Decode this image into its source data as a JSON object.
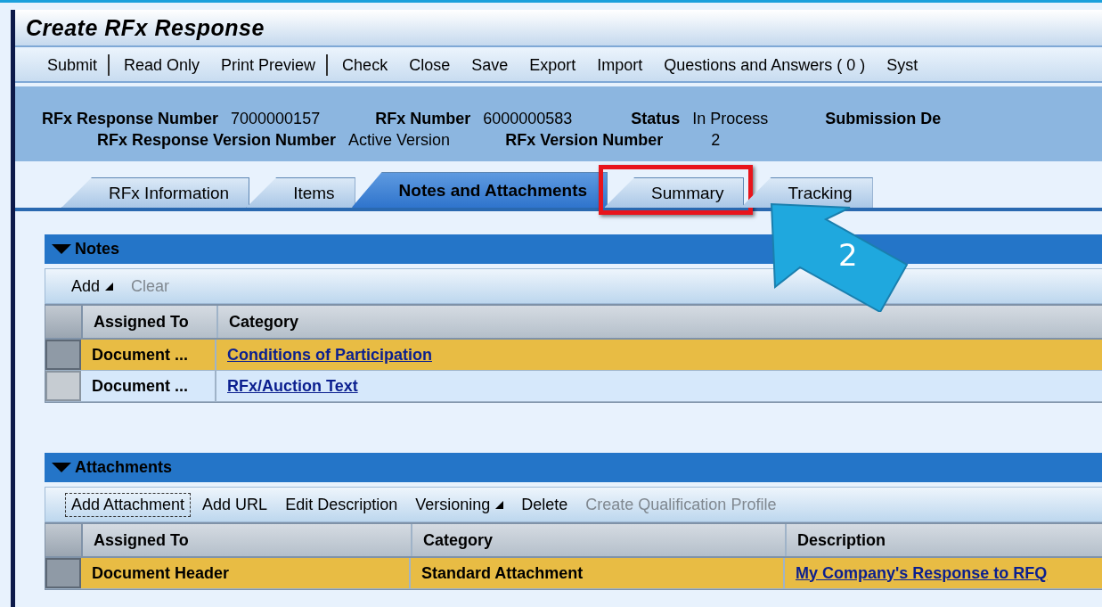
{
  "window": {
    "title": "Create RFx Response"
  },
  "toolbar": [
    {
      "label": "Submit",
      "separator_after": true
    },
    {
      "label": "Read Only",
      "separator_after": false
    },
    {
      "label": "Print Preview",
      "separator_after": true
    },
    {
      "label": "Check",
      "separator_after": false
    },
    {
      "label": "Close",
      "separator_after": false
    },
    {
      "label": "Save",
      "separator_after": false
    },
    {
      "label": "Export",
      "separator_after": false
    },
    {
      "label": "Import",
      "separator_after": false
    },
    {
      "label": "Questions and Answers ( 0 )",
      "separator_after": false
    },
    {
      "label": "Syst",
      "separator_after": false
    }
  ],
  "header": {
    "rows": [
      [
        {
          "label": "RFx Response Number",
          "value": "7000000157"
        },
        {
          "label": "RFx Number",
          "value": "6000000583"
        },
        {
          "label": "Status",
          "value": "In Process"
        },
        {
          "label": "Submission De"
        }
      ],
      [
        {
          "label": "RFx Response Version Number",
          "value": "Active Version"
        },
        {
          "label": "RFx Version Number",
          "value": "2"
        }
      ]
    ]
  },
  "tabs": [
    {
      "label": "RFx Information",
      "selected": false,
      "highlighted": false
    },
    {
      "label": "Items",
      "selected": false,
      "highlighted": false
    },
    {
      "label": "Notes and Attachments",
      "selected": true,
      "highlighted": false
    },
    {
      "label": "Summary",
      "selected": false,
      "highlighted": true
    },
    {
      "label": "Tracking",
      "selected": false,
      "highlighted": false
    }
  ],
  "callout": {
    "number": "2"
  },
  "sections": [
    {
      "title": "Notes",
      "expanded": true,
      "actions": [
        {
          "label": "Add",
          "menu": true,
          "disabled": false,
          "focused": false
        },
        {
          "label": "Clear",
          "menu": false,
          "disabled": true,
          "focused": false
        }
      ],
      "columns": [
        "Assigned To",
        "Category"
      ],
      "rows": [
        {
          "selected": true,
          "cells": [
            {
              "text": "Document ...",
              "link": false
            },
            {
              "text": "Conditions of Participation",
              "link": true
            }
          ]
        },
        {
          "selected": false,
          "cells": [
            {
              "text": "Document ...",
              "link": false
            },
            {
              "text": "RFx/Auction Text",
              "link": true
            }
          ]
        }
      ]
    },
    {
      "title": "Attachments",
      "expanded": true,
      "actions": [
        {
          "label": "Add Attachment",
          "menu": false,
          "disabled": false,
          "focused": true
        },
        {
          "label": "Add URL",
          "menu": false,
          "disabled": false,
          "focused": false
        },
        {
          "label": "Edit Description",
          "menu": false,
          "disabled": false,
          "focused": false
        },
        {
          "label": "Versioning",
          "menu": true,
          "disabled": false,
          "focused": false
        },
        {
          "label": "Delete",
          "menu": false,
          "disabled": false,
          "focused": false
        },
        {
          "label": "Create Qualification Profile",
          "menu": false,
          "disabled": true,
          "focused": false
        }
      ],
      "columns": [
        "Assigned To",
        "Category",
        "Description"
      ],
      "rows": [
        {
          "selected": true,
          "cells": [
            {
              "text": "Document Header",
              "link": false
            },
            {
              "text": "Standard Attachment",
              "link": false
            },
            {
              "text": "My Company's Response to RFQ",
              "link": true
            }
          ]
        }
      ]
    }
  ]
}
